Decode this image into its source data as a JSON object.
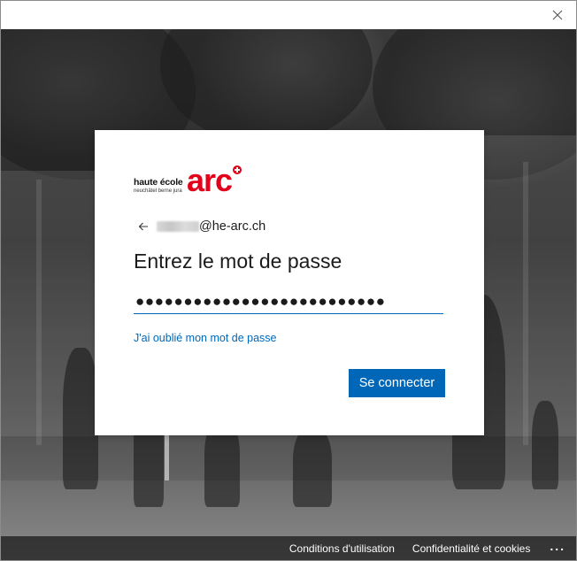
{
  "window": {
    "close_icon": "close-icon"
  },
  "branding": {
    "main_text": "haute école",
    "sub_text": "neuchâtel berne jura",
    "arc_text": "arc",
    "brand_color": "#e2001a"
  },
  "identity": {
    "back_icon": "arrow-left-icon",
    "domain": "@he-arc.ch"
  },
  "form": {
    "heading": "Entrez le mot de passe",
    "password_masked": "●●●●●●●●●●●●●●●●●●●●●●●●●●",
    "forgot_password": "J'ai oublié mon mot de passe",
    "submit_label": "Se connecter",
    "accent_color": "#0067b8"
  },
  "footer": {
    "terms": "Conditions d'utilisation",
    "privacy": "Confidentialité et cookies",
    "more": "..."
  }
}
